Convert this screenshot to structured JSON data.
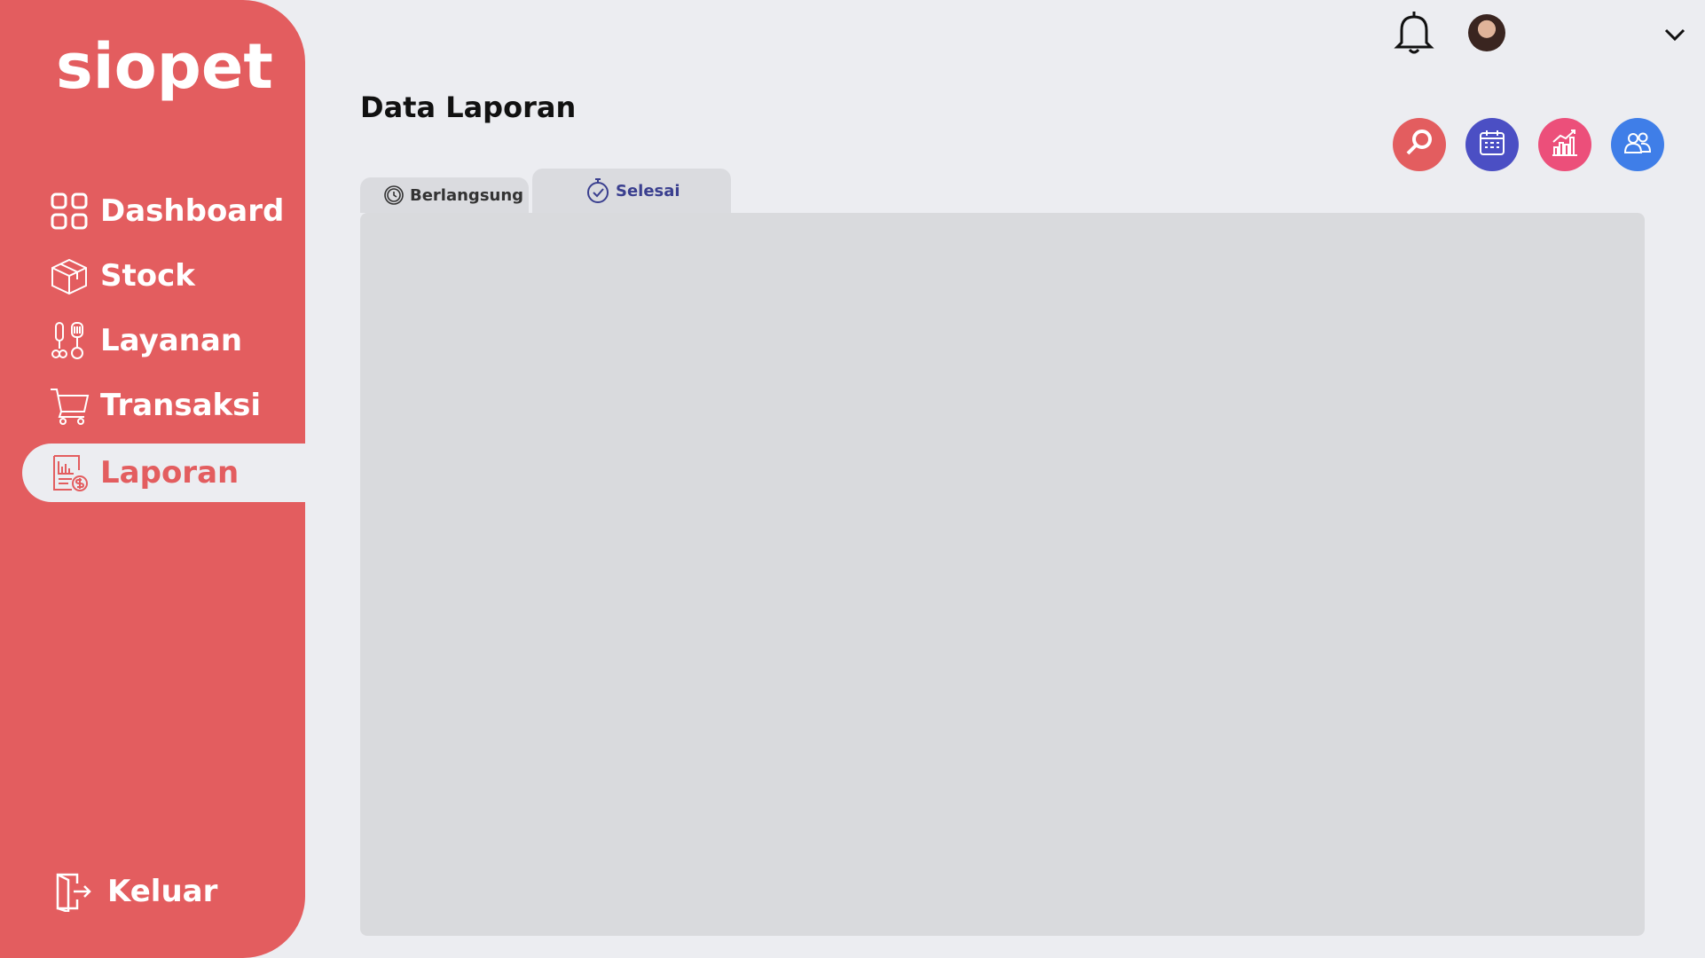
{
  "app": {
    "logo_text": "siopet"
  },
  "sidebar": {
    "items": [
      {
        "label": "Dashboard",
        "icon": "grid-icon",
        "active": false
      },
      {
        "label": "Stock",
        "icon": "box-icon",
        "active": false
      },
      {
        "label": "Layanan",
        "icon": "grooming-icon",
        "active": false
      },
      {
        "label": "Transaksi",
        "icon": "cart-icon",
        "active": false
      },
      {
        "label": "Laporan",
        "icon": "report-icon",
        "active": true
      }
    ],
    "logout_label": "Keluar"
  },
  "header": {
    "page_title": "Data Laporan"
  },
  "actions": [
    {
      "name": "search",
      "color": "#e35d5f"
    },
    {
      "name": "calendar",
      "color": "#4b4fc4"
    },
    {
      "name": "chart",
      "color": "#ec4f7a"
    },
    {
      "name": "users",
      "color": "#3f7ee8"
    }
  ],
  "tabs": [
    {
      "label": "Berlangsung",
      "active": false
    },
    {
      "label": "Selesai",
      "active": true
    }
  ],
  "colors": {
    "sidebar": "#e35d5f",
    "background": "#ecedf1",
    "panel": "#d9dadd",
    "active_tab_text": "#3a3f8f"
  }
}
